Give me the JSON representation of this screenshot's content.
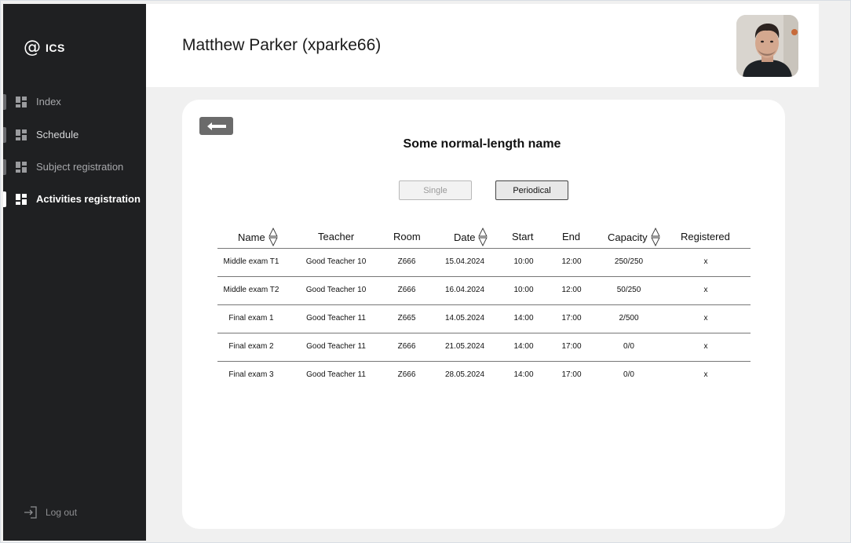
{
  "sidebar": {
    "logo_text": "ICS",
    "items": [
      {
        "label": "Index",
        "active": false
      },
      {
        "label": "Schedule",
        "active": false
      },
      {
        "label": "Subject registration",
        "active": false
      },
      {
        "label": "Activities registration",
        "active": true
      }
    ],
    "logout_label": "Log out"
  },
  "header": {
    "user_name": "Matthew Parker (xparke66)"
  },
  "card": {
    "title": "Some normal-length name",
    "toggle_single": "Single",
    "toggle_periodical": "Periodical",
    "selected_toggle": "Periodical"
  },
  "table": {
    "headers": {
      "name": "Name",
      "teacher": "Teacher",
      "room": "Room",
      "date": "Date",
      "start": "Start",
      "end": "End",
      "capacity": "Capacity",
      "registered": "Registered"
    },
    "rows": [
      {
        "name": "Middle exam T1",
        "teacher": "Good Teacher 10",
        "room": "Z666",
        "date": "15.04.2024",
        "start": "10:00",
        "end": "12:00",
        "capacity": "250/250",
        "registered": "x"
      },
      {
        "name": "Middle exam T2",
        "teacher": "Good Teacher 10",
        "room": "Z666",
        "date": "16.04.2024",
        "start": "10:00",
        "end": "12:00",
        "capacity": "50/250",
        "registered": "x"
      },
      {
        "name": "Final exam 1",
        "teacher": "Good Teacher 11",
        "room": "Z665",
        "date": "14.05.2024",
        "start": "14:00",
        "end": "17:00",
        "capacity": "2/500",
        "registered": "x"
      },
      {
        "name": "Final exam 2",
        "teacher": "Good Teacher 11",
        "room": "Z666",
        "date": "21.05.2024",
        "start": "14:00",
        "end": "17:00",
        "capacity": "0/0",
        "registered": "x"
      },
      {
        "name": "Final exam 3",
        "teacher": "Good Teacher 11",
        "room": "Z666",
        "date": "28.05.2024",
        "start": "14:00",
        "end": "17:00",
        "capacity": "0/0",
        "registered": "x"
      }
    ]
  },
  "colors": {
    "sidebar_bg": "#1f2022",
    "page_bg": "#f0f0f0",
    "card_bg": "#ffffff",
    "back_button": "#6b6b6b"
  },
  "icons": {
    "logo": "at-sign-icon",
    "nav": "dashboard-grid-icon",
    "logout": "log-out-icon",
    "back": "arrow-left-icon",
    "sort": "sort-up-down-icon"
  }
}
